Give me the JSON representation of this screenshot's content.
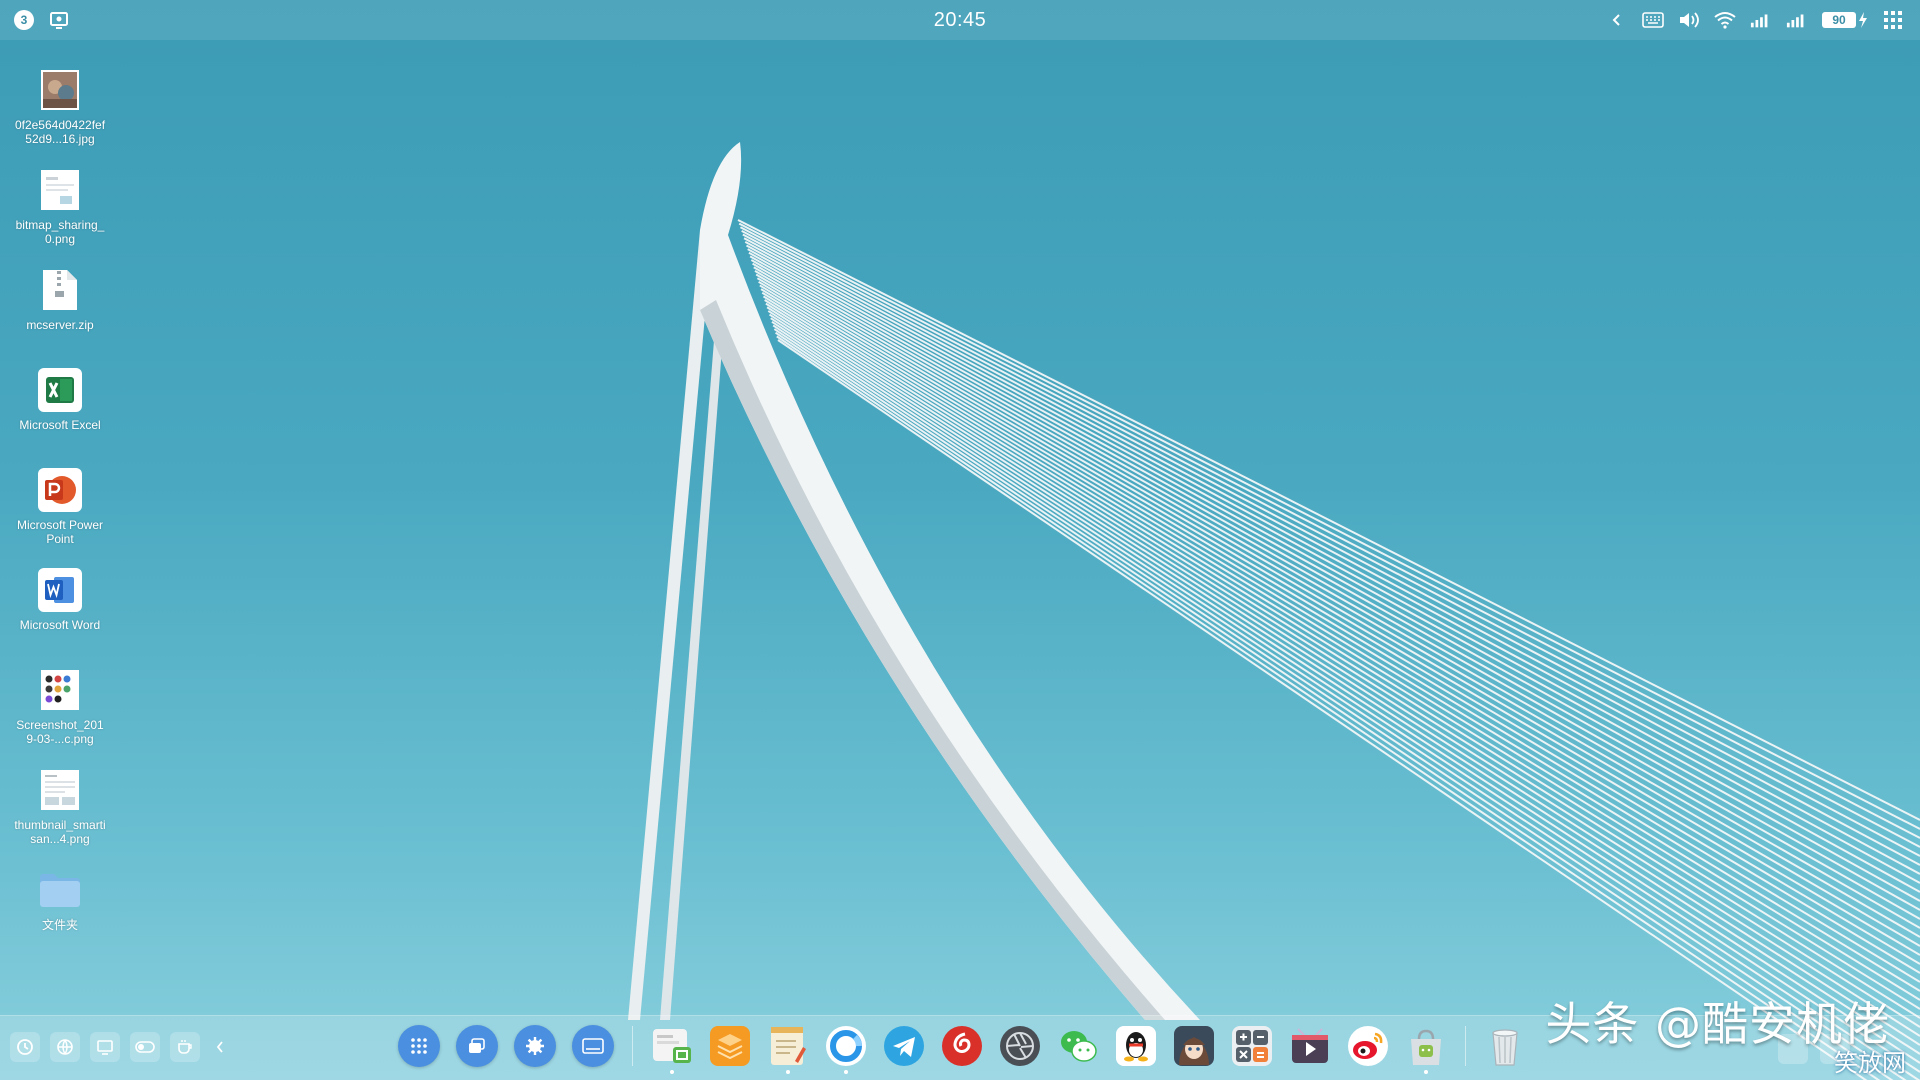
{
  "status_bar": {
    "notification_count": "3",
    "time": "20:45",
    "battery": "90"
  },
  "desktop_icons": [
    {
      "label": "0f2e564d0422fef52d9...16.jpg",
      "icon": "image-thumbnail-icon"
    },
    {
      "label": "bitmap_sharing_0.png",
      "icon": "image-file-icon"
    },
    {
      "label": "mcserver.zip",
      "icon": "zip-file-icon"
    },
    {
      "label": "Microsoft Excel",
      "icon": "excel-icon"
    },
    {
      "label": "Microsoft PowerPoint",
      "icon": "powerpoint-icon"
    },
    {
      "label": "Microsoft Word",
      "icon": "word-icon"
    },
    {
      "label": "Screenshot_2019-03-...c.png",
      "icon": "screenshot-file-icon"
    },
    {
      "label": "thumbnail_smartisan...4.png",
      "icon": "thumbnail-file-icon"
    },
    {
      "label": "文件夹",
      "icon": "folder-icon"
    }
  ],
  "dock": {
    "system_buttons": [
      "app-launcher-icon",
      "multitask-icon",
      "settings-icon",
      "keyboard-icon"
    ],
    "apps": [
      "file-manager-icon",
      "layers-app-icon",
      "notes-icon",
      "browser-icon",
      "telegram-icon",
      "netease-music-icon",
      "camera-aperture-icon",
      "wechat-icon",
      "qq-icon",
      "anime-avatar-icon",
      "calculator-icon",
      "video-player-icon",
      "weibo-icon",
      "app-store-icon",
      "trash-icon"
    ]
  },
  "watermark": {
    "text": "头条 @酷安机佬",
    "site": "笑放网"
  },
  "colors": {
    "sky_top": "#3c9bb5",
    "sky_bottom": "#8ad0de",
    "bridge": "#f2f5f6",
    "dock_system": "#4a8fe0"
  }
}
